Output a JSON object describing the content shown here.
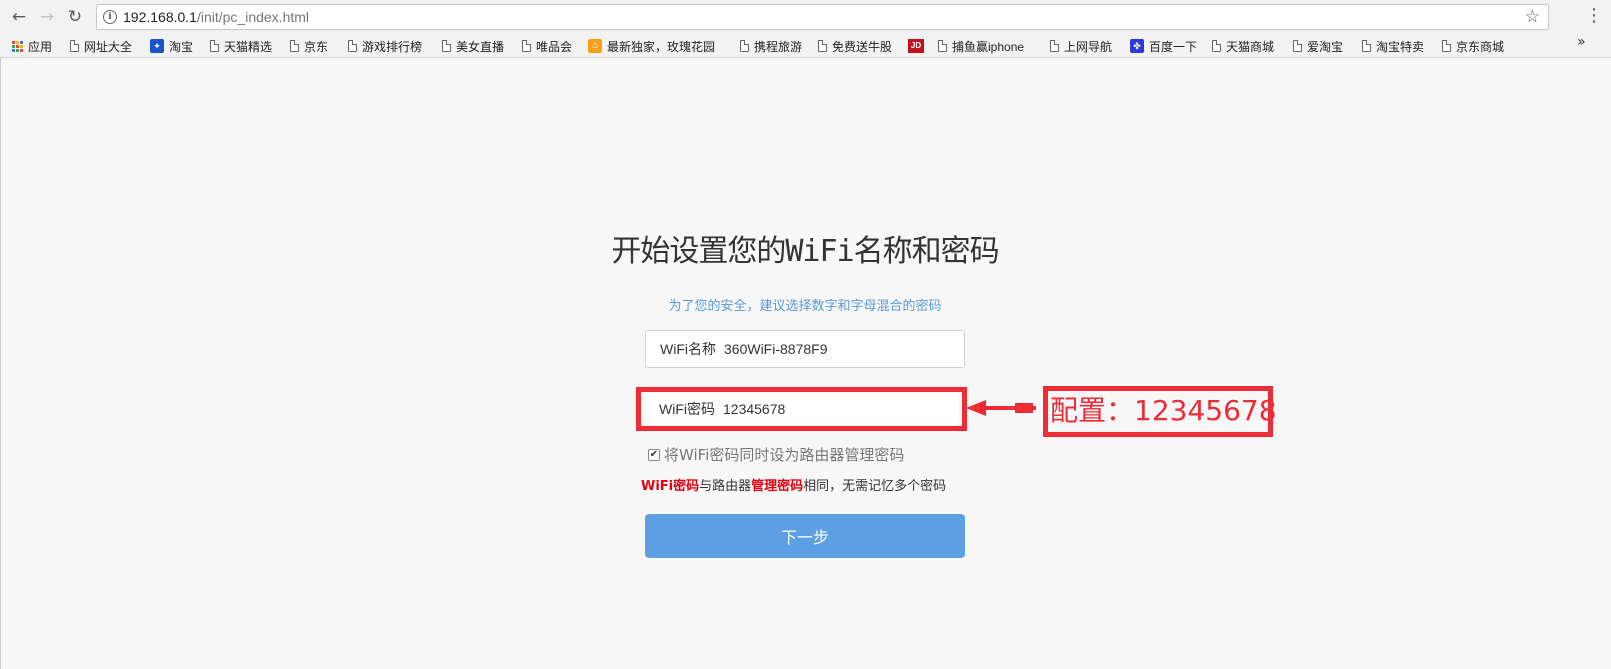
{
  "browser": {
    "url_host": "192.168.0.1",
    "url_path": "/init/pc_index.html",
    "nav": {
      "back_glyph": "←",
      "forward_glyph": "→",
      "reload_glyph": "↻",
      "star_glyph": "☆",
      "menu_glyph": "⋮",
      "info_glyph": "i"
    },
    "bookmarks_more": "»",
    "bookmarks": [
      {
        "label": "应用",
        "icon": "apps-icon"
      },
      {
        "label": "网址大全",
        "icon": "page-icon"
      },
      {
        "label": "淘宝",
        "icon": "taobao-icon"
      },
      {
        "label": "天猫精选",
        "icon": "page-icon"
      },
      {
        "label": "京东",
        "icon": "page-icon"
      },
      {
        "label": "游戏排行榜",
        "icon": "page-icon"
      },
      {
        "label": "美女直播",
        "icon": "page-icon"
      },
      {
        "label": "唯品会",
        "icon": "page-icon"
      },
      {
        "label": "最新独家，玫瑰花园",
        "icon": "home-icon"
      },
      {
        "label": "携程旅游",
        "icon": "page-icon"
      },
      {
        "label": "免费送牛股",
        "icon": "page-icon"
      },
      {
        "label": "",
        "icon": "jd-icon",
        "icon_text": "JD"
      },
      {
        "label": "捕鱼赢iphone",
        "icon": "page-icon"
      },
      {
        "label": "上网导航",
        "icon": "page-icon"
      },
      {
        "label": "百度一下",
        "icon": "baidu-icon"
      },
      {
        "label": "天猫商城",
        "icon": "page-icon"
      },
      {
        "label": "爱淘宝",
        "icon": "page-icon"
      },
      {
        "label": "淘宝特卖",
        "icon": "page-icon"
      },
      {
        "label": "京东商城",
        "icon": "page-icon"
      }
    ]
  },
  "setup": {
    "title": "开始设置您的WiFi名称和密码",
    "subtitle": "为了您的安全，建议选择数字和字母混合的密码",
    "wifi_name_label": "WiFi名称",
    "wifi_name_value": "360WiFi-8878F9",
    "wifi_password_label": "WiFi密码",
    "wifi_password_value": "12345678",
    "checkbox_checked": true,
    "checkbox_label": "将WiFi密码同时设为路由器管理密码",
    "note": {
      "part1": "WiFi密码",
      "part2": "与路由器",
      "part3": "管理密码",
      "part4": "相同，无需记忆多个密码"
    },
    "next_button": "下一步"
  },
  "annotation": {
    "callout_text": "配置：12345678",
    "color": "#ee2c36"
  },
  "colors": {
    "accent": "#5ca0e3",
    "subtitle": "#5a9ad6",
    "highlight": "#e60012"
  }
}
